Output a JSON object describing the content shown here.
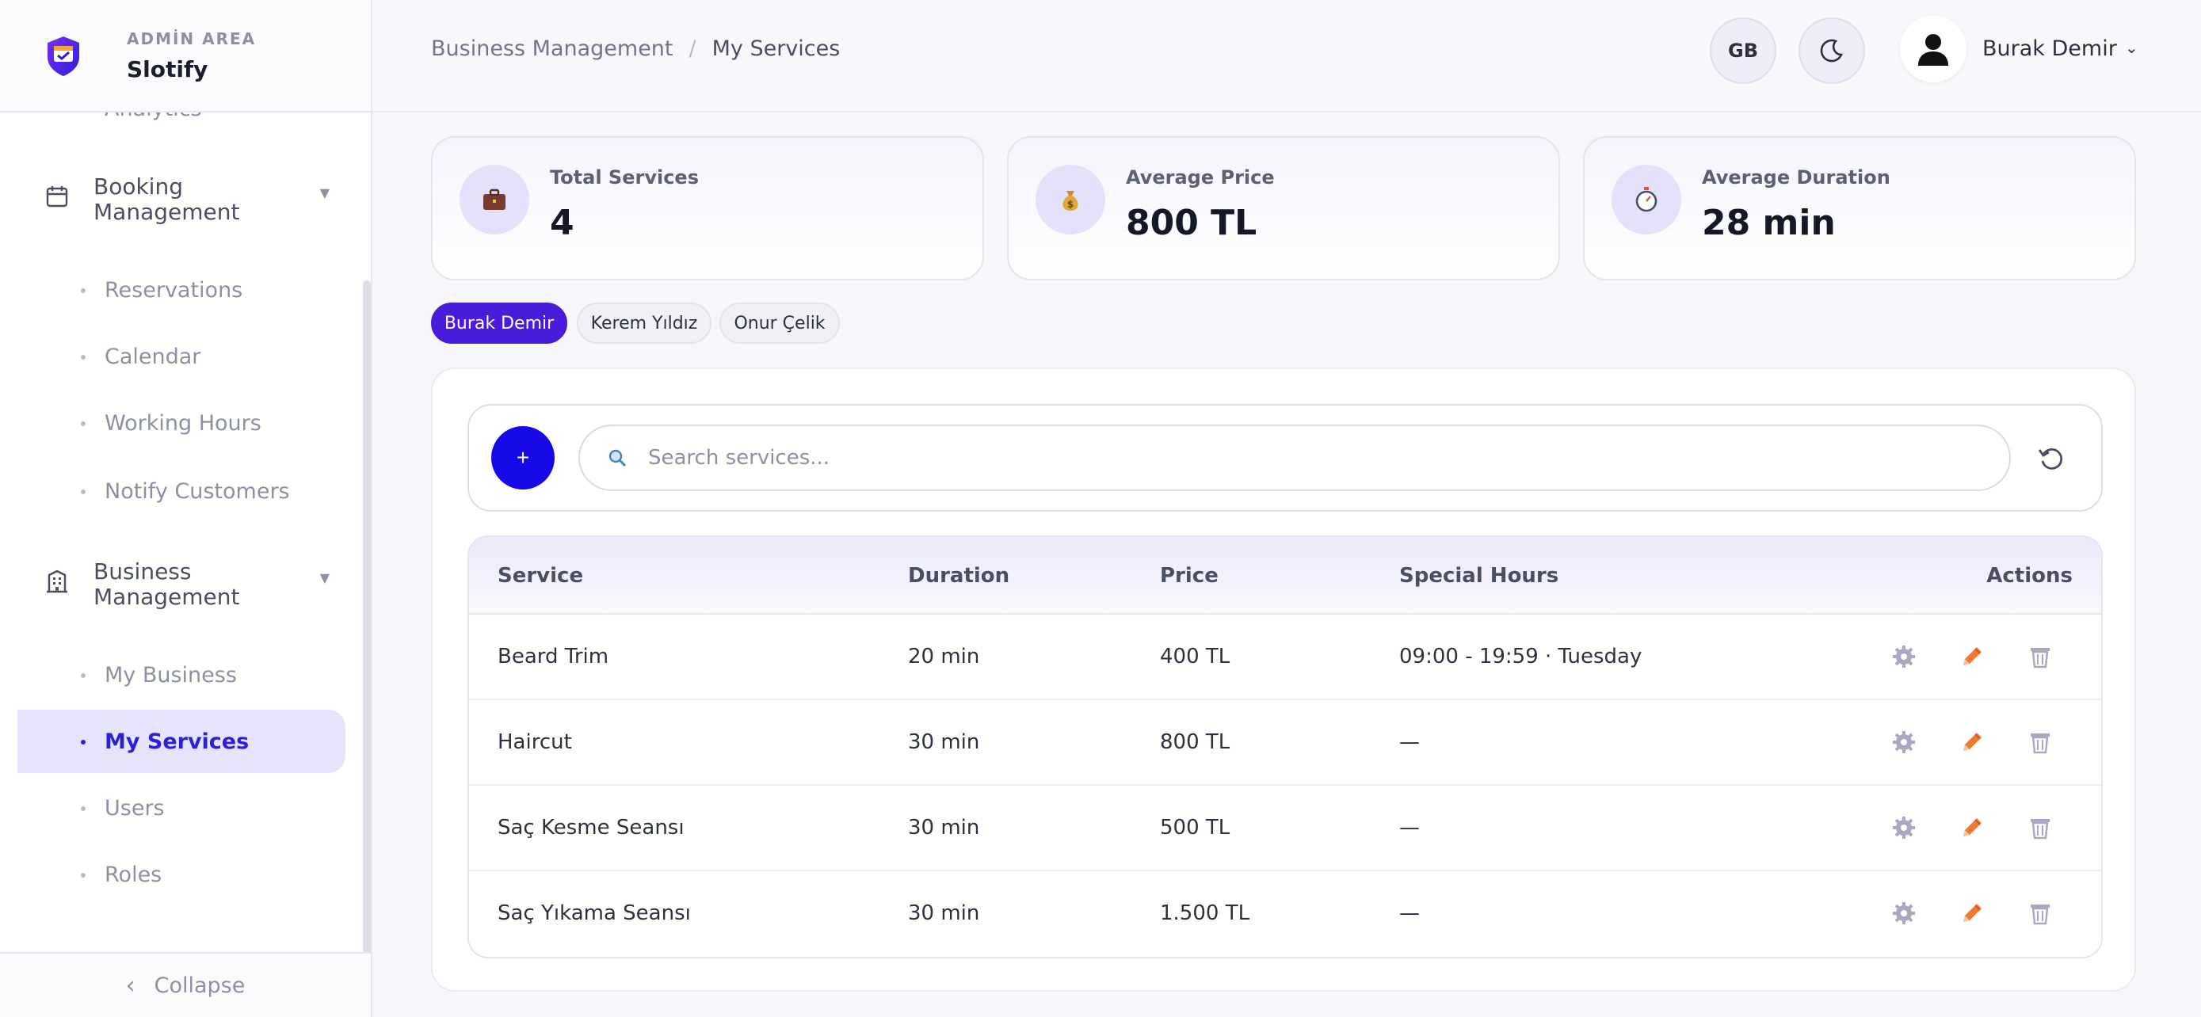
{
  "sidebar": {
    "brand_sub": "ADMİN AREA",
    "brand_title": "Slotify",
    "cut_item": "Analytics",
    "groups": [
      {
        "label": "Booking Management",
        "icon": "calendar-icon",
        "items": [
          "Reservations",
          "Calendar",
          "Working Hours",
          "Notify Customers"
        ]
      },
      {
        "label": "Business Management",
        "icon": "building-icon",
        "items": [
          "My Business",
          "My Services",
          "Users",
          "Roles"
        ]
      }
    ],
    "active_item": "My Services",
    "collapse_label": "Collapse"
  },
  "header": {
    "breadcrumb": [
      "Business Management",
      "My Services"
    ],
    "language": "GB",
    "theme_icon": "moon-icon",
    "user_name": "Burak Demir"
  },
  "stats": [
    {
      "label": "Total Services",
      "value": "4",
      "icon": "briefcase-icon"
    },
    {
      "label": "Average Price",
      "value": "800 TL",
      "icon": "money-bag-icon"
    },
    {
      "label": "Average Duration",
      "value": "28 min",
      "icon": "stopwatch-icon"
    }
  ],
  "staff": {
    "options": [
      "Burak Demir",
      "Kerem Yıldız",
      "Onur Çelik"
    ],
    "selected": "Burak Demir"
  },
  "toolbar": {
    "add_label": "+",
    "search_placeholder": "Search services..."
  },
  "table": {
    "columns": [
      "Service",
      "Duration",
      "Price",
      "Special Hours",
      "Actions"
    ],
    "rows": [
      {
        "service": "Beard Trim",
        "duration": "20 min",
        "price": "400 TL",
        "special_hours": "09:00 - 19:59 · Tuesday"
      },
      {
        "service": "Haircut",
        "duration": "30 min",
        "price": "800 TL",
        "special_hours": "—"
      },
      {
        "service": "Saç Kesme Seansı",
        "duration": "30 min",
        "price": "500 TL",
        "special_hours": "—"
      },
      {
        "service": "Saç Yıkama Seansı",
        "duration": "30 min",
        "price": "1.500 TL",
        "special_hours": "—"
      }
    ]
  },
  "colors": {
    "accent": "#2d1ed8",
    "add_button": "#1708e6",
    "chip_active": "#4a1bd8",
    "edit_icon": "#f07a35"
  }
}
